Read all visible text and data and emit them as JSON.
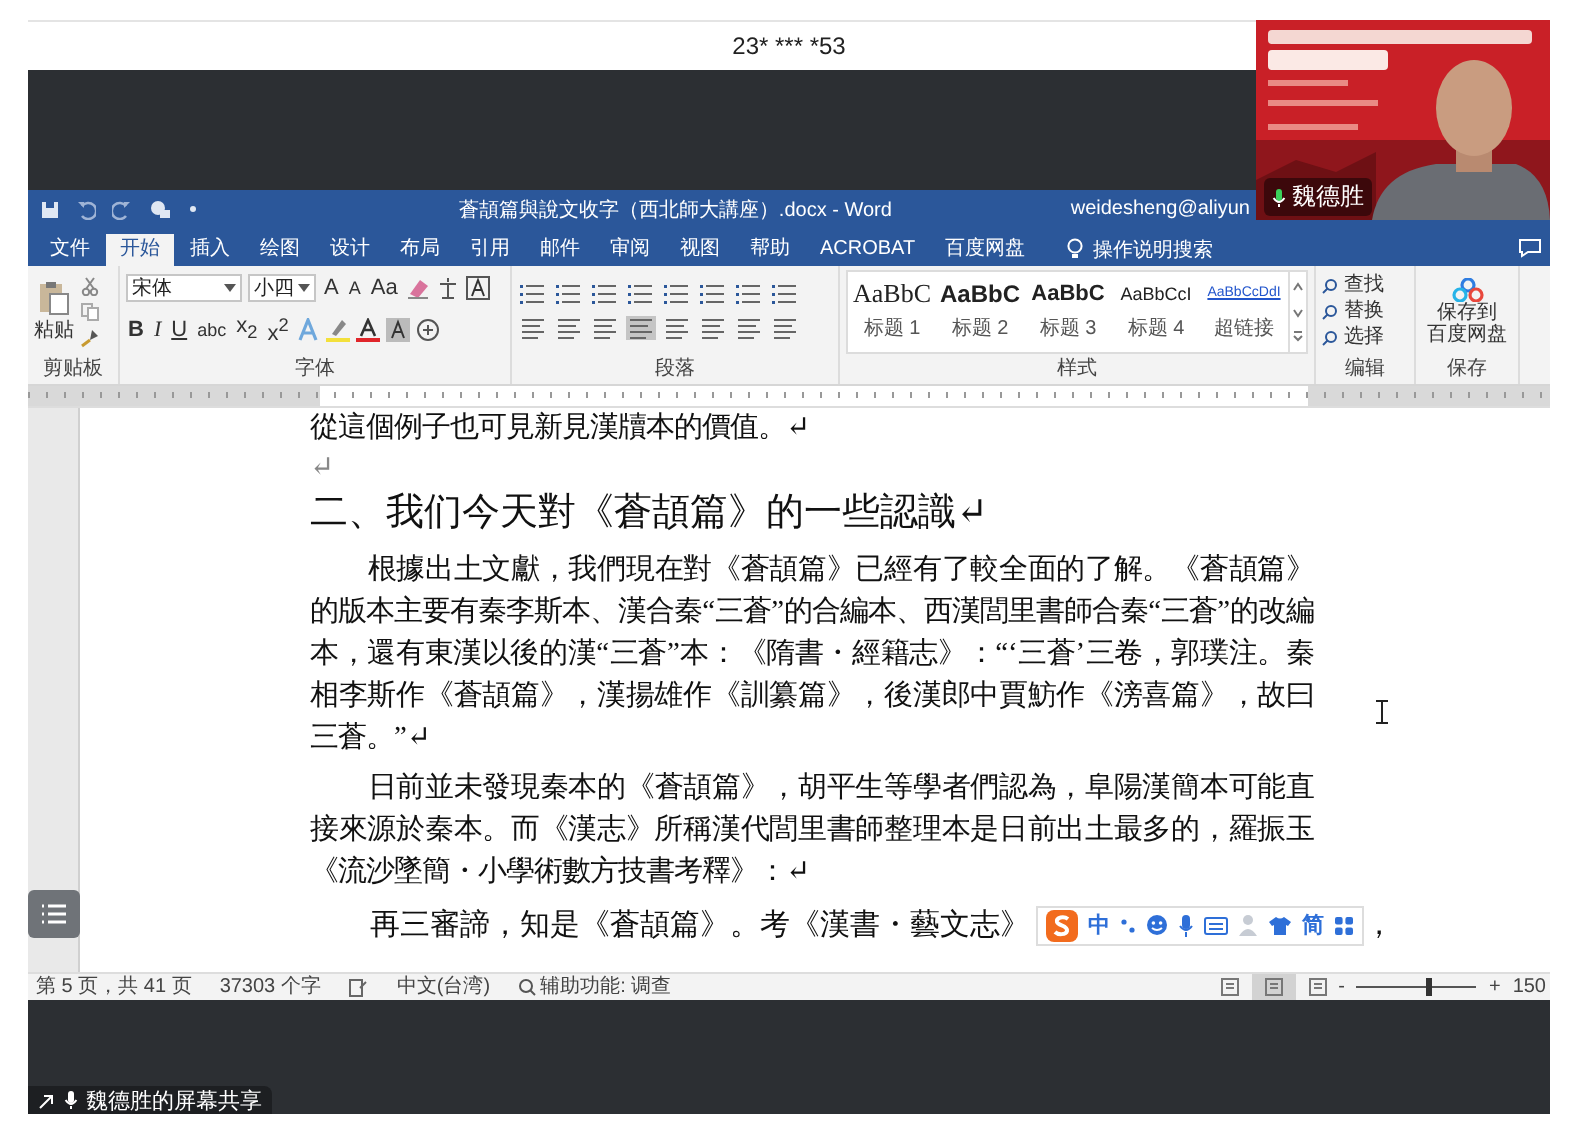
{
  "meeting": {
    "title": "23* *** *53",
    "share_label": "魏德胜的屏幕共享"
  },
  "webcam": {
    "name": "魏德胜"
  },
  "word": {
    "title": "蒼頡篇與說文收字（西北師大講座）.docx - Word",
    "account": "weidesheng@aliyun",
    "tabs": [
      {
        "label": "文件",
        "selected": false
      },
      {
        "label": "开始",
        "selected": true
      },
      {
        "label": "插入",
        "selected": false
      },
      {
        "label": "绘图",
        "selected": false
      },
      {
        "label": "设计",
        "selected": false
      },
      {
        "label": "布局",
        "selected": false
      },
      {
        "label": "引用",
        "selected": false
      },
      {
        "label": "邮件",
        "selected": false
      },
      {
        "label": "审阅",
        "selected": false
      },
      {
        "label": "视图",
        "selected": false
      },
      {
        "label": "帮助",
        "selected": false
      },
      {
        "label": "ACROBAT",
        "selected": false
      },
      {
        "label": "百度网盘",
        "selected": false
      }
    ],
    "search": "操作说明搜索",
    "ribbon": {
      "clipboard": {
        "paste": "粘贴",
        "label": "剪贴板"
      },
      "font": {
        "name": "宋体",
        "size": "小四",
        "row1": [
          "A",
          "A",
          "Aa"
        ],
        "row2": [
          "B",
          "I",
          "U",
          "abc",
          "x$_{2}$",
          "x$^{2}$"
        ],
        "label": "字体"
      },
      "paragraph": {
        "label": "段落"
      },
      "styles": {
        "items": [
          {
            "kind": "heading1",
            "sample": "AaBbC",
            "label": "标题 1"
          },
          {
            "kind": "heading2",
            "sample": "AaBbC",
            "label": "标题 2"
          },
          {
            "kind": "heading3",
            "sample": "AaBbC",
            "label": "标题 3"
          },
          {
            "kind": "heading4",
            "sample": "AaBbCcI",
            "label": "标题 4"
          },
          {
            "kind": "hyperlink",
            "sample": "AaBbCcDdI",
            "label": "超链接"
          }
        ],
        "label": "样式"
      },
      "editing": {
        "items": [
          "查找",
          "替换",
          "选择"
        ],
        "label": "编辑"
      },
      "save": {
        "lines": [
          "保存到",
          "百度网盘"
        ],
        "label": "保存"
      }
    },
    "document": [
      {
        "kind": "body",
        "text": "從這個例子也可見新見漢牘本的價值。↵"
      },
      {
        "kind": "blank",
        "text": "↵"
      },
      {
        "kind": "heading",
        "text": "二、我们今天對《蒼頡篇》的一些認識↵"
      },
      {
        "kind": "body",
        "text": "根據出土文獻，我們現在對《蒼頡篇》已經有了較全面的了解。《蒼頡篇》的版本主要有秦李斯本、漢合秦“三蒼”的合編本、西漢閭里書師合秦“三蒼”的改編本，還有東漢以後的漢“三蒼”本：《隋書・經籍志》：“‘三蒼’三卷，郭璞注。秦相李斯作《蒼頡篇》，漢揚雄作《訓纂篇》，後漢郎中賈魴作《滂喜篇》，故曰三蒼。”↵"
      },
      {
        "kind": "body",
        "text": "日前並未發現秦本的《蒼頡篇》，胡平生等學者們認為，阜陽漢簡本可能直接來源於秦本。而《漢志》所稱漢代閭里書師整理本是日前出土最多的，羅振玉《流沙墜簡・小學術數方技書考釋》：↵"
      },
      {
        "kind": "quote",
        "text": "再三審諦，知是《蒼頡篇》。考《漢書・藝文志》",
        "after": "，"
      }
    ],
    "ime": {
      "mode": "中",
      "script": "简"
    },
    "status": {
      "page": "第 5 页，共 41 页",
      "words": "37303 个字",
      "language": "中文(台湾)",
      "accessibility": "辅助功能: 调查",
      "views": [
        {
          "selected": false
        },
        {
          "selected": true
        },
        {
          "selected": false
        }
      ],
      "zoom_out": "-",
      "zoom_in": "+",
      "zoom": {
        "level": 0.6
      },
      "zoom_value": "150"
    }
  }
}
